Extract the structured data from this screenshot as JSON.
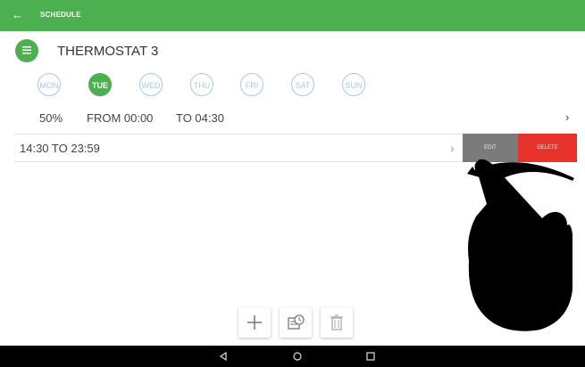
{
  "app": {
    "title": "SCHEDULE"
  },
  "device": {
    "name": "THERMOSTAT 3",
    "icon": "thermostat-icon"
  },
  "days": [
    {
      "label": "MON",
      "active": false
    },
    {
      "label": "TUE",
      "active": true
    },
    {
      "label": "WED",
      "active": false
    },
    {
      "label": "THU",
      "active": false
    },
    {
      "label": "FRI",
      "active": false
    },
    {
      "label": "SAT",
      "active": false
    },
    {
      "label": "SUN",
      "active": false
    }
  ],
  "schedule": [
    {
      "level": "50%",
      "from": "FROM 00:00",
      "to": "TO 04:30"
    },
    {
      "text": "14:30   TO 23:59"
    }
  ],
  "swipe_actions": {
    "edit": "EDIT",
    "delete": "DELETE"
  },
  "toolbar": {
    "add_icon": "plus-icon",
    "copy_icon": "copy-schedule-icon",
    "delete_icon": "trash-icon"
  },
  "navbar": {
    "back_icon": "nav-back-icon",
    "home_icon": "nav-home-icon",
    "recents_icon": "nav-recents-icon"
  },
  "colors": {
    "primary": "#4caf50",
    "day_outline": "#a9c8ea",
    "edit": "#7b7b7b",
    "delete": "#e8322c",
    "navbar": "#000000"
  }
}
